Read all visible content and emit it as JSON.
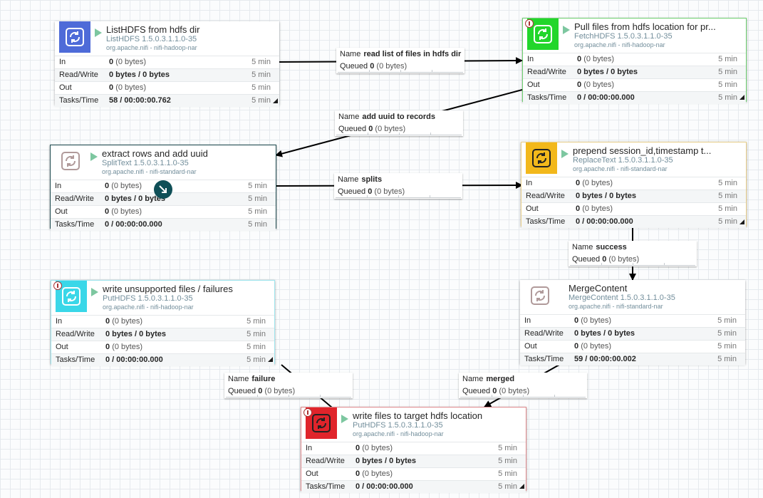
{
  "colors": {
    "blue": "#4e6bd8",
    "green": "#22d62b",
    "gold": "#f2b81b",
    "cyan": "#3ad7e8",
    "red": "#e0242b",
    "white_icon_bg": "#ffffff"
  },
  "stat_labels": {
    "in": "In",
    "rw": "Read/Write",
    "out": "Out",
    "tasks": "Tasks/Time"
  },
  "time_window": "5 min",
  "connection_labels": {
    "name": "Name",
    "queued": "Queued"
  },
  "processors": [
    {
      "id": "listhdfs",
      "name": "ListHDFS from hdfs dir",
      "type": "ListHDFS 1.5.0.3.1.1.0-35",
      "bundle": "org.apache.nifi - nifi-hadoop-nar",
      "icon_color": "blue",
      "badge": false,
      "in_count": "0",
      "in_size": "(0 bytes)",
      "rw": "0 bytes / 0 bytes",
      "out_count": "0",
      "out_size": "(0 bytes)",
      "tasks": "58 / 00:00:00.762"
    },
    {
      "id": "fetchhdfs",
      "name": "Pull files from hdfs location for pr...",
      "type": "FetchHDFS 1.5.0.3.1.1.0-35",
      "bundle": "org.apache.nifi - nifi-hadoop-nar",
      "icon_color": "green",
      "badge": true,
      "in_count": "0",
      "in_size": "(0 bytes)",
      "rw": "0 bytes / 0 bytes",
      "out_count": "0",
      "out_size": "(0 bytes)",
      "tasks": "0 / 00:00:00.000"
    },
    {
      "id": "splittext",
      "name": "extract rows and add uuid",
      "type": "SplitText 1.5.0.3.1.1.0-35",
      "bundle": "org.apache.nifi - nifi-standard-nar",
      "icon_color": "white_icon_bg",
      "badge": false,
      "in_count": "0",
      "in_size": "(0 bytes)",
      "rw": "0 bytes / 0 bytes",
      "out_count": "0",
      "out_size": "(0 bytes)",
      "tasks": "0 / 00:00:00.000"
    },
    {
      "id": "replacetext",
      "name": "prepend session_id,timestamp t...",
      "type": "ReplaceText 1.5.0.3.1.1.0-35",
      "bundle": "org.apache.nifi - nifi-standard-nar",
      "icon_color": "gold",
      "badge": false,
      "in_count": "0",
      "in_size": "(0 bytes)",
      "rw": "0 bytes / 0 bytes",
      "out_count": "0",
      "out_size": "(0 bytes)",
      "tasks": "0 / 00:00:00.000"
    },
    {
      "id": "puthdfs_fail",
      "name": "write unsupported files / failures",
      "type": "PutHDFS 1.5.0.3.1.1.0-35",
      "bundle": "org.apache.nifi - nifi-hadoop-nar",
      "icon_color": "cyan",
      "badge": true,
      "in_count": "0",
      "in_size": "(0 bytes)",
      "rw": "0 bytes / 0 bytes",
      "out_count": "0",
      "out_size": "(0 bytes)",
      "tasks": "0 / 00:00:00.000"
    },
    {
      "id": "mergecontent",
      "name": "MergeContent",
      "type": "MergeContent 1.5.0.3.1.1.0-35",
      "bundle": "org.apache.nifi - nifi-standard-nar",
      "icon_color": "white_icon_bg",
      "badge": false,
      "in_count": "0",
      "in_size": "(0 bytes)",
      "rw": "0 bytes / 0 bytes",
      "out_count": "0",
      "out_size": "(0 bytes)",
      "tasks": "59 / 00:00:00.002"
    },
    {
      "id": "puthdfs_target",
      "name": "write files to target hdfs location",
      "type": "PutHDFS 1.5.0.3.1.1.0-35",
      "bundle": "org.apache.nifi - nifi-hadoop-nar",
      "icon_color": "red",
      "badge": true,
      "in_count": "0",
      "in_size": "(0 bytes)",
      "rw": "0 bytes / 0 bytes",
      "out_count": "0",
      "out_size": "(0 bytes)",
      "tasks": "0 / 00:00:00.000"
    }
  ],
  "connections": [
    {
      "id": "c1",
      "name": "read list of files in hdfs dir",
      "queued_count": "0",
      "queued_size": "(0 bytes)"
    },
    {
      "id": "c2",
      "name": "add uuid to records",
      "queued_count": "0",
      "queued_size": "(0 bytes)"
    },
    {
      "id": "c3",
      "name": "splits",
      "queued_count": "0",
      "queued_size": "(0 bytes)"
    },
    {
      "id": "c4",
      "name": "success",
      "queued_count": "0",
      "queued_size": "(0 bytes)"
    },
    {
      "id": "c5",
      "name": "failure",
      "queued_count": "0",
      "queued_size": "(0 bytes)"
    },
    {
      "id": "c6",
      "name": "merged",
      "queued_count": "0",
      "queued_size": "(0 bytes)"
    }
  ]
}
